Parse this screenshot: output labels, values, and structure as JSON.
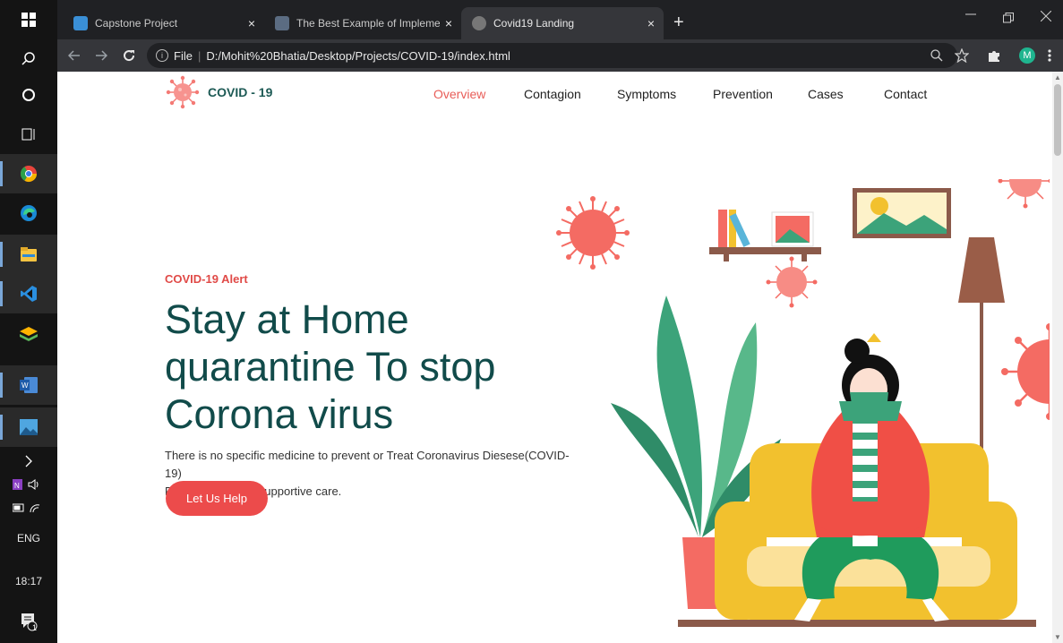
{
  "taskbar": {
    "lang": "ENG",
    "time": "18:17",
    "notification_count": "1"
  },
  "browser": {
    "tabs": [
      {
        "title": "Capstone Project",
        "close": "×",
        "active": false,
        "favicon_color": "#3a8fd6"
      },
      {
        "title": "The Best Example of Implementa",
        "close": "×",
        "active": false,
        "favicon_color": "#5b6c82"
      },
      {
        "title": "Covid19 Landing",
        "close": "×",
        "active": true,
        "favicon_color": "#777777"
      }
    ],
    "new_tab": "+",
    "address": {
      "scheme_label": "File",
      "url": "D:/Mohit%20Bhatia/Desktop/Projects/COVID-19/index.html"
    },
    "profile_initial": "M"
  },
  "site": {
    "logo_text": "COVID - 19",
    "nav": [
      "Overview",
      "Contagion",
      "Symptoms",
      "Prevention",
      "Cases",
      "Contact"
    ],
    "active_nav": "Overview",
    "hero": {
      "alert": "COVID-19 Alert",
      "headline": "Stay at Home quarantine To stop Corona virus",
      "description_line1": "There is no specific medicine to prevent or Treat Coronavirus Diesese(COVID-19)",
      "description_line2": "People may need supportive care.",
      "cta": "Let Us Help"
    }
  },
  "colors": {
    "brand_dark": "#114b4a",
    "accent_red": "#ec4b4b",
    "nav_active": "#e85d58",
    "sofa_yellow": "#f2c12e",
    "virus_red": "#f46b63"
  }
}
